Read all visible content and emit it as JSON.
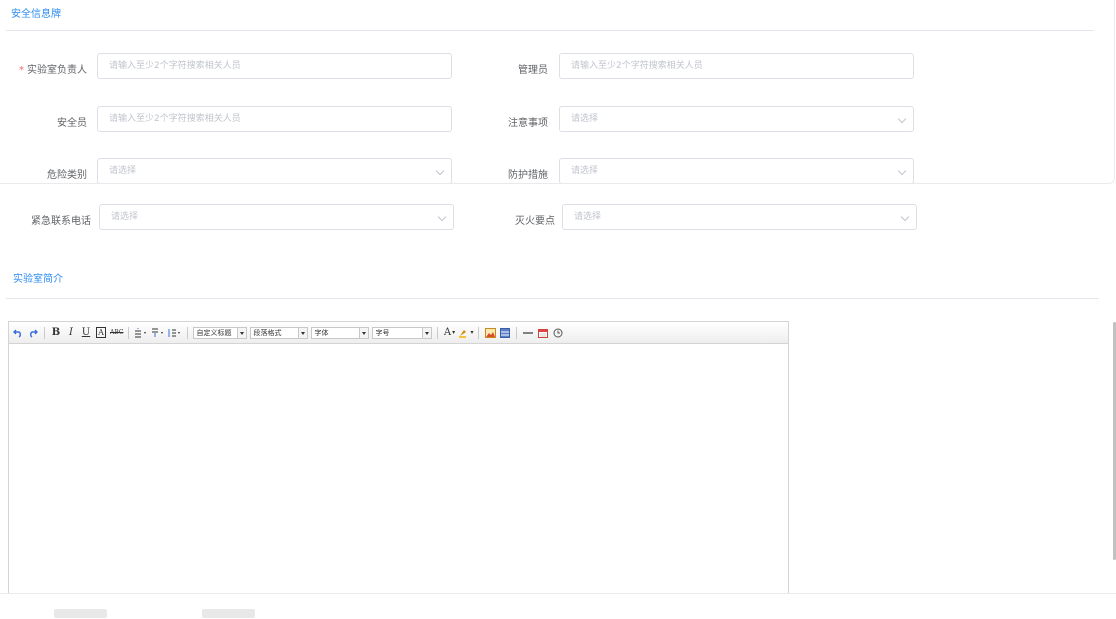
{
  "card": {
    "title": "安全信息牌",
    "fields": [
      {
        "label": "实验室负责人",
        "required": true,
        "placeholder": "请输入至少2个字符搜索相关人员",
        "type": "search"
      },
      {
        "label": "管理员",
        "required": false,
        "placeholder": "请输入至少2个字符搜索相关人员",
        "type": "search"
      },
      {
        "label": "安全员",
        "required": false,
        "placeholder": "请输入至少2个字符搜索相关人员",
        "type": "search"
      },
      {
        "label": "注意事项",
        "required": false,
        "placeholder": "请选择",
        "type": "select"
      },
      {
        "label": "危险类别",
        "required": false,
        "placeholder": "请选择",
        "type": "select"
      },
      {
        "label": "防护措施",
        "required": false,
        "placeholder": "请选择",
        "type": "select"
      }
    ]
  },
  "form2": {
    "fields": [
      {
        "label": "紧急联系电话",
        "placeholder": "请选择",
        "type": "select"
      },
      {
        "label": "灭火要点",
        "placeholder": "请选择",
        "type": "select"
      }
    ]
  },
  "intro": {
    "title": "实验室简介"
  },
  "editor": {
    "combos": {
      "custom_heading": "自定义标题",
      "paragraph": "段落格式",
      "font_family": "字体",
      "font_size": "字号"
    },
    "text_color_glyph": "A"
  },
  "colors": {
    "accent": "#2d8cf0",
    "required": "#f56c6c",
    "border": "#dcdfe6",
    "placeholder": "#c0c4cc"
  }
}
